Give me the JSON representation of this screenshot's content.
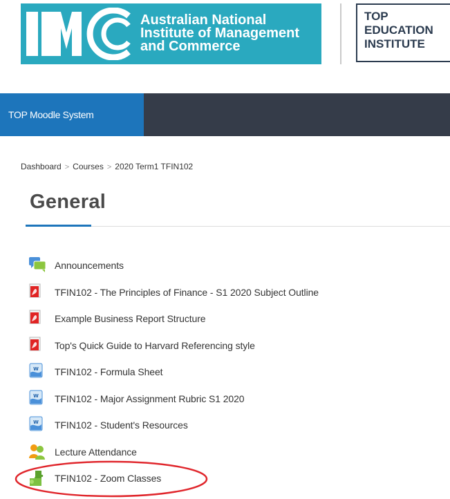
{
  "header": {
    "imc_logo_lines": [
      "Australian National",
      "Institute of Management",
      "and Commerce"
    ],
    "top_logo_lines": [
      "TOP",
      "EDUCATION",
      "INSTITUTE"
    ]
  },
  "navbar": {
    "brand": "TOP Moodle System"
  },
  "breadcrumb": {
    "items": [
      "Dashboard",
      "Courses",
      "2020 Term1 TFIN102"
    ],
    "separator": ">"
  },
  "section": {
    "title": "General"
  },
  "activities": [
    {
      "label": "Announcements",
      "icon": "forum-icon"
    },
    {
      "label": "TFIN102 - The Principles of Finance - S1 2020 Subject Outline",
      "icon": "pdf-icon"
    },
    {
      "label": "Example Business Report Structure",
      "icon": "pdf-icon"
    },
    {
      "label": "Top's Quick Guide to Harvard Referencing style",
      "icon": "pdf-icon"
    },
    {
      "label": "TFIN102 - Formula Sheet",
      "icon": "word-document-icon"
    },
    {
      "label": "TFIN102 - Major Assignment Rubric S1 2020",
      "icon": "word-document-icon"
    },
    {
      "label": "TFIN102 - Student's Resources",
      "icon": "word-document-icon"
    },
    {
      "label": "Lecture Attendance",
      "icon": "attendance-icon"
    },
    {
      "label": "TFIN102 - Zoom Classes",
      "icon": "plugin-puzzle-icon"
    }
  ],
  "colors": {
    "logo_teal": "#2aa9bf",
    "navbar_dark": "#353c49",
    "navbar_brand_blue": "#1d75bb",
    "highlight_red": "#e0262c"
  }
}
